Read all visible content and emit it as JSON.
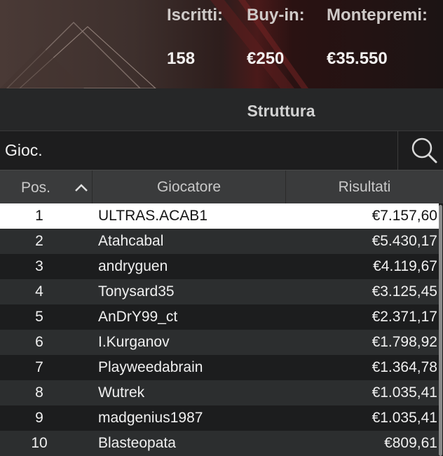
{
  "header": {
    "stats": [
      {
        "label": "Iscritti:",
        "value": "158"
      },
      {
        "label": "Buy-in:",
        "value": "€250"
      },
      {
        "label": "Montepremi:",
        "value": "€35.550"
      }
    ]
  },
  "tab": {
    "label": "Struttura"
  },
  "search": {
    "value": "Gioc.",
    "icon": "search-icon"
  },
  "table": {
    "columns": [
      "Pos.",
      "Giocatore",
      "Risultati"
    ],
    "sort_icon": "chevron-up-icon",
    "rows": [
      {
        "pos": "1",
        "name": "ULTRAS.ACAB1",
        "result": "€7.157,60"
      },
      {
        "pos": "2",
        "name": "Atahcabal",
        "result": "€5.430,17"
      },
      {
        "pos": "3",
        "name": "andryguen",
        "result": "€4.119,67"
      },
      {
        "pos": "4",
        "name": "Tonysard35",
        "result": "€3.125,45"
      },
      {
        "pos": "5",
        "name": "AnDrY99_ct",
        "result": "€2.371,17"
      },
      {
        "pos": "6",
        "name": "I.Kurganov",
        "result": "€1.798,92"
      },
      {
        "pos": "7",
        "name": "Playweedabrain",
        "result": "€1.364,78"
      },
      {
        "pos": "8",
        "name": "Wutrek",
        "result": "€1.035,41"
      },
      {
        "pos": "9",
        "name": "madgenius1987",
        "result": "€1.035,41"
      },
      {
        "pos": "10",
        "name": "Blasteopata",
        "result": "€809,61"
      }
    ]
  }
}
